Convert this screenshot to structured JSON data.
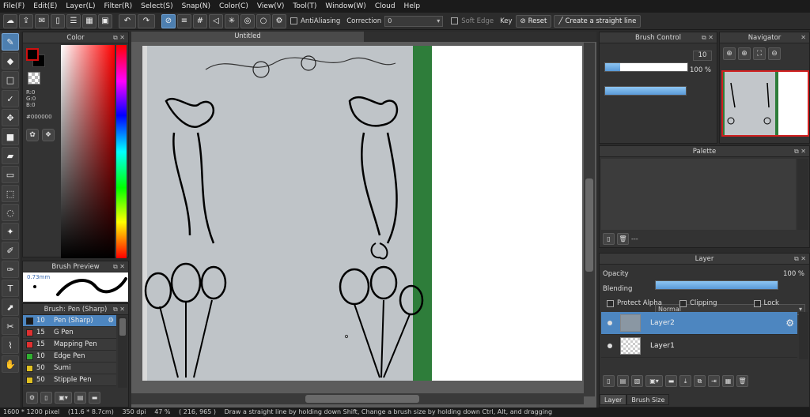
{
  "menu": [
    "File(F)",
    "Edit(E)",
    "Layer(L)",
    "Filter(R)",
    "Select(S)",
    "Snap(N)",
    "Color(C)",
    "View(V)",
    "Tool(T)",
    "Window(W)",
    "Cloud",
    "Help"
  ],
  "toolbar": {
    "antialiasing_label": "AntiAliasing",
    "correction_label": "Correction",
    "correction_value": "0",
    "soft_edge_label": "Soft Edge",
    "key_label": "Key",
    "reset_label": "Reset",
    "straight_line_label": "Create a straight line"
  },
  "color_panel": {
    "title": "Color",
    "r": "R:0",
    "g": "G:0",
    "b": "B:0",
    "hex": "#000000"
  },
  "brush_preview": {
    "title": "Brush Preview",
    "size": "0.73mm"
  },
  "brush_list": {
    "title": "Brush: Pen (Sharp)",
    "items": [
      {
        "size": "10",
        "name": "Pen (Sharp)",
        "color": "#1a1a1a",
        "selected": true
      },
      {
        "size": "15",
        "name": "G Pen",
        "color": "#e03030"
      },
      {
        "size": "15",
        "name": "Mapping Pen",
        "color": "#e03030"
      },
      {
        "size": "10",
        "name": "Edge Pen",
        "color": "#30b030"
      },
      {
        "size": "50",
        "name": "Sumi",
        "color": "#e0c020"
      },
      {
        "size": "50",
        "name": "Stipple Pen",
        "color": "#e0c020"
      }
    ]
  },
  "canvas": {
    "tab_title": "Untitled"
  },
  "brush_control": {
    "title": "Brush Control",
    "size_value": "10",
    "size_fill_fraction": 0.18,
    "opacity_value": "100 %",
    "opacity_fill_fraction": 1.0
  },
  "navigator": {
    "title": "Navigator"
  },
  "palette": {
    "title": "Palette",
    "page_label": "---"
  },
  "layer_panel": {
    "title": "Layer",
    "opacity_label": "Opacity",
    "opacity_value": "100 %",
    "blending_label": "Blending",
    "blending_value": "Normal",
    "protect_alpha_label": "Protect Alpha",
    "clipping_label": "Clipping",
    "lock_label": "Lock",
    "layers": [
      {
        "name": "Layer2",
        "selected": true
      },
      {
        "name": "Layer1",
        "selected": false
      }
    ]
  },
  "bottom_tabs": [
    "Layer",
    "Brush Size"
  ],
  "status": {
    "dimensions": "1600 * 1200 pixel",
    "physical": "(11.6 * 8.7cm)",
    "dpi": "350 dpi",
    "zoom": "47 %",
    "coords": "( 216, 965 )",
    "hint": "Draw a straight line by holding down Shift, Change a brush size by holding down Ctrl, Alt, and dragging"
  },
  "colors": {
    "accent": "#4d86c0",
    "selection": "#d02020"
  }
}
